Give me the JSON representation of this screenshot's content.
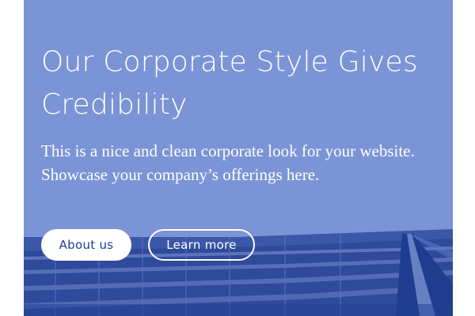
{
  "hero": {
    "headline": "Our Corporate Style Gives Credibility",
    "subtext": "This is a nice and clean corporate look for your website. Showcase your company’s offerings here.",
    "background_color": "#7b94d6",
    "accent_color": "#1f3c8f"
  },
  "buttons": {
    "about_label": "About us",
    "learn_label": "Learn more"
  }
}
